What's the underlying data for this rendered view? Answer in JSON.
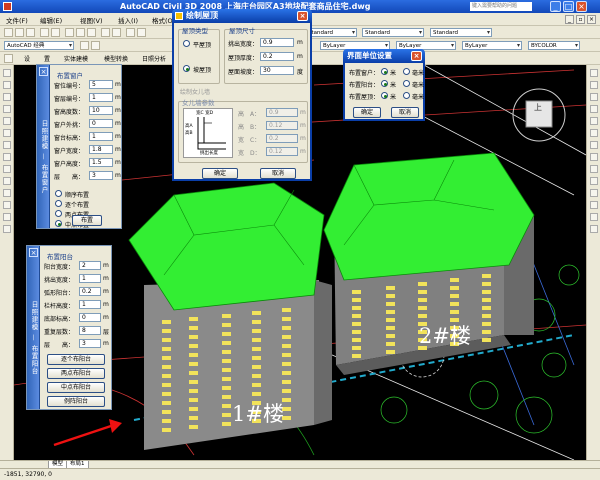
{
  "window": {
    "title": "AutoCAD Civil 3D 2008 上海庄台园区A3地块配套商品住宅.dwg",
    "search_placeholder": "键入需要帮助的问题",
    "min": "_",
    "max": "□",
    "close": "×"
  },
  "menu": [
    "文件(F)",
    "编辑(E)",
    "视图(V)",
    "插入(I)",
    "格式(O)"
  ],
  "toolbar": {
    "style": "Standard",
    "layer": "ByLayer",
    "layer2": "ByLayer",
    "linetype": "ByLayer",
    "color": "BYCOLOR",
    "dimstyle": "Standard",
    "workspace": "AutoCAD 经典"
  },
  "tabs": [
    "设",
    "置",
    "实体建模",
    "模型转换",
    "日照分析",
    "日"
  ],
  "tpl_tab": "模型",
  "tpl_tab2": "布局1",
  "status_coords": "-1851, 32790, 0",
  "buildings": [
    "1#楼",
    "2#楼"
  ],
  "panel1": {
    "strip": "日照建模 — 布置窗户",
    "group": "布置窗户",
    "rows": [
      {
        "label": "窗位编号：",
        "value": "5"
      },
      {
        "label": "窗层编号：",
        "value": "1"
      },
      {
        "label": "窗高度数：",
        "value": "10"
      },
      {
        "label": "窗户外挑：",
        "value": "0"
      },
      {
        "label": "窗台标高：",
        "value": "1"
      },
      {
        "label": "窗户宽度：",
        "value": "1.8"
      },
      {
        "label": "窗户高度：",
        "value": "1.5"
      },
      {
        "label": "层　　高：",
        "value": "3"
      }
    ],
    "unit": "m",
    "radios": [
      "顺序布置",
      "逐个布置",
      "两点布置",
      "中点布置"
    ],
    "radio_selected": 3,
    "button": "布置"
  },
  "panel2": {
    "strip": "日照建模 — 布置阳台",
    "group": "布置阳台",
    "rows": [
      {
        "label": "阳台宽度：",
        "value": "2"
      },
      {
        "label": "挑出宽度：",
        "value": "1"
      },
      {
        "label": "弧形阳台：",
        "value": "0.2"
      },
      {
        "label": "栏杆高度：",
        "value": "1"
      },
      {
        "label": "底部标高：",
        "value": "0"
      },
      {
        "label": "重复层数：",
        "value": "8"
      },
      {
        "label": "层　　高：",
        "value": "3"
      }
    ],
    "units": [
      "m",
      "m",
      "m",
      "m",
      "m",
      "层",
      "m"
    ],
    "buttons": [
      "逐个布阳台",
      "两点布阳台",
      "中点布阳台",
      "例阵阳台"
    ]
  },
  "roof": {
    "title": "绘制屋顶",
    "type_group": "屋顶类型",
    "types": [
      "平屋顶",
      "坡屋顶"
    ],
    "type_selected": 1,
    "size_group": "屋顶尺寸",
    "rows": [
      {
        "label": "挑出宽度：",
        "value": "0.9",
        "unit": "m"
      },
      {
        "label": "屋顶厚度：",
        "value": "0.2",
        "unit": "m"
      },
      {
        "label": "屋面坡度：",
        "value": "30",
        "unit": "度"
      }
    ],
    "wall_check": "绘制女儿墙",
    "wall_group": "女儿墙参数",
    "wall_rows": [
      {
        "label": "高　A：",
        "value": "0.9"
      },
      {
        "label": "高　B：",
        "value": "0.12"
      },
      {
        "label": "宽　C：",
        "value": "0.2"
      },
      {
        "label": "宽　D：",
        "value": "0.12"
      }
    ],
    "sketch": {
      "top": "宽C 宽D",
      "side": "高A 高B",
      "bottom": "挑出长度"
    },
    "ok": "确定",
    "cancel": "取消"
  },
  "units": {
    "title": "界面单位设置",
    "rows": [
      {
        "label": "布置窗户：",
        "options": [
          "米",
          "毫米"
        ],
        "selected": 0
      },
      {
        "label": "布置阳台：",
        "options": [
          "米",
          "毫米"
        ],
        "selected": 0
      },
      {
        "label": "布置屋顶：",
        "options": [
          "米",
          "毫米"
        ],
        "selected": 0
      }
    ],
    "ok": "确定",
    "cancel": "取消"
  },
  "viewcube_top": "上",
  "colors": {
    "roof": "#33ee33",
    "facade": "#8e8e8e",
    "window": "#f2e35a",
    "canvas": "#000000",
    "accent": "#0a3ea8"
  }
}
